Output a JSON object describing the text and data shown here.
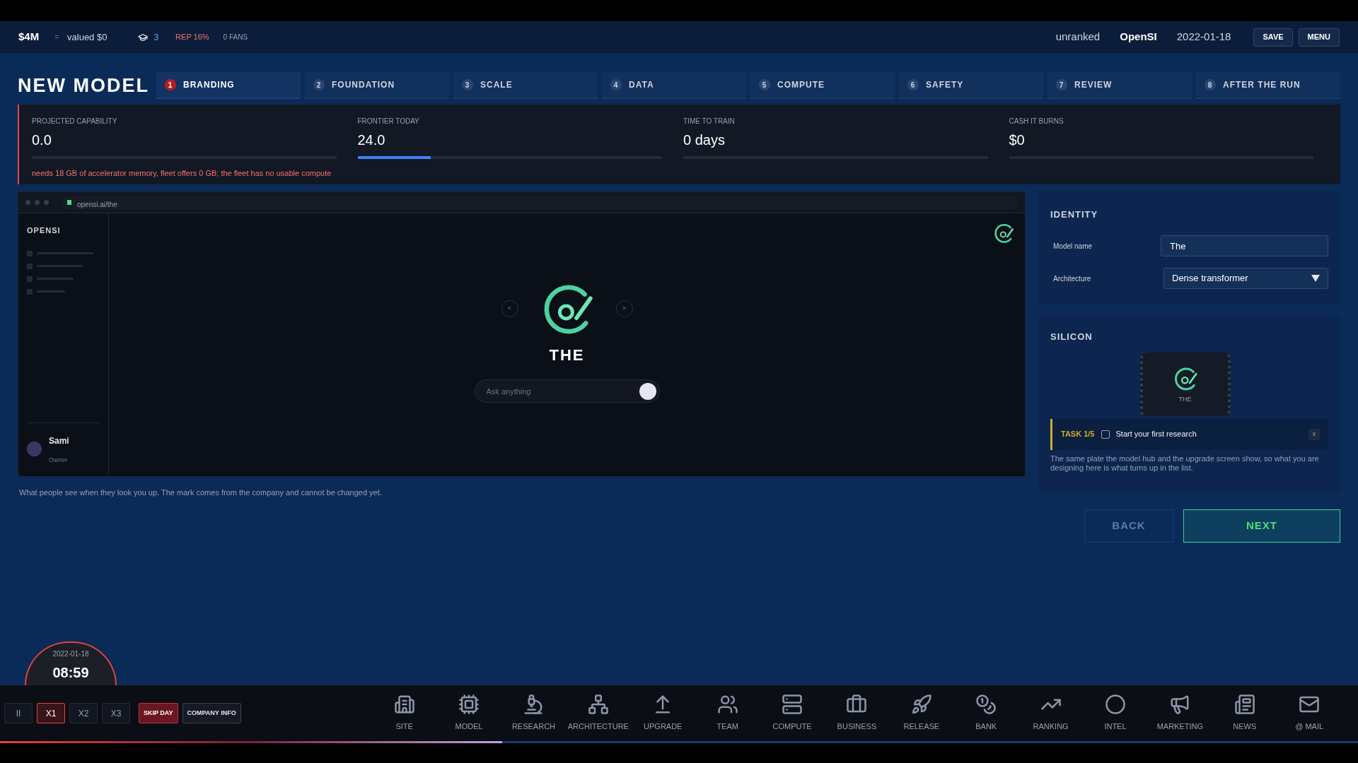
{
  "top_bar": {
    "cash": "$4M",
    "separator": "=",
    "valuation": "valued $0",
    "researchers": "3",
    "reputation": "REP 16%",
    "fans": "0 FANS",
    "rank": "unranked",
    "company": "OpenSI",
    "date": "2022-01-18",
    "buttons": [
      "SAVE",
      "MENU"
    ]
  },
  "page_title": "NEW MODEL",
  "steps": [
    {
      "number": "1",
      "label": "BRANDING",
      "selected": true
    },
    {
      "number": "2",
      "label": "FOUNDATION",
      "selected": false
    },
    {
      "number": "3",
      "label": "SCALE",
      "selected": false
    },
    {
      "number": "4",
      "label": "DATA",
      "selected": false
    },
    {
      "number": "5",
      "label": "COMPUTE",
      "selected": false
    },
    {
      "number": "6",
      "label": "SAFETY",
      "selected": false
    },
    {
      "number": "7",
      "label": "REVIEW",
      "selected": false
    },
    {
      "number": "8",
      "label": "AFTER THE RUN",
      "selected": false
    }
  ],
  "stats": [
    {
      "label": "PROJECTED CAPABILITY",
      "value": "0.0",
      "level": 0
    },
    {
      "label": "FRONTIER TODAY",
      "value": "24.0",
      "level": 0.24
    },
    {
      "label": "TIME TO TRAIN",
      "value": "0 days",
      "level": 0
    },
    {
      "label": "CASH IT BURNS",
      "value": "$0",
      "level": 0
    }
  ],
  "warning": "needs 18 GB of accelerator memory, fleet offers 0 GB; the fleet has no usable compute",
  "preview": {
    "url": "opensi.ai/the",
    "brand": "OPENSI",
    "model_name": "THE",
    "search_placeholder": "Ask anything",
    "user": {
      "name": "Sami",
      "role": "Owner"
    },
    "prev": "<",
    "next": ">"
  },
  "preview_caption": "What people see when they look you up. The mark comes from the company and cannot be changed yet.",
  "identity": {
    "title": "IDENTITY",
    "fields": [
      {
        "label": "Model name",
        "kind": "text",
        "value": "The"
      },
      {
        "label": "Architecture",
        "kind": "select",
        "value": "Dense transformer"
      }
    ]
  },
  "silicon": {
    "title": "SILICON",
    "chip_label": "THE",
    "description": "The same plate the model hub and the upgrade screen show, so what you are designing here is what turns up in the list."
  },
  "task": {
    "title": "TASK 1/5",
    "close": "x",
    "items": [
      {
        "label": "Start your first research",
        "checked": false
      }
    ]
  },
  "actions": [
    {
      "label": "BACK",
      "disabled": true
    },
    {
      "label": "NEXT",
      "disabled": false
    }
  ],
  "clock": {
    "date": "2022-01-18",
    "time": "08:59"
  },
  "speed": [
    {
      "label": "II",
      "selected": false
    },
    {
      "label": "X1",
      "selected": true
    },
    {
      "label": "X2",
      "selected": false
    },
    {
      "label": "X3",
      "selected": false
    }
  ],
  "controls": [
    {
      "label": "SKIP DAY",
      "kind": "danger"
    },
    {
      "label": "COMPANY INFO",
      "kind": "plain"
    }
  ],
  "nav": [
    {
      "label": "SITE",
      "kind": "site"
    },
    {
      "label": "MODEL",
      "kind": "model"
    },
    {
      "label": "RESEARCH",
      "kind": "research"
    },
    {
      "label": "ARCHITECTURE",
      "kind": "architecture"
    },
    {
      "label": "UPGRADE",
      "kind": "upgrade"
    },
    {
      "label": "TEAM",
      "kind": "team"
    },
    {
      "label": "COMPUTE",
      "kind": "compute"
    },
    {
      "label": "BUSINESS",
      "kind": "business"
    },
    {
      "label": "RELEASE",
      "kind": "release"
    },
    {
      "label": "BANK",
      "kind": "bank"
    },
    {
      "label": "RANKING",
      "kind": "ranking"
    },
    {
      "label": "INTEL",
      "kind": "intel"
    },
    {
      "label": "MARKETING",
      "kind": "marketing"
    },
    {
      "label": "NEWS",
      "kind": "news"
    },
    {
      "label": "@ MAIL",
      "kind": "mail"
    }
  ],
  "day_progress": {
    "level": 0.37
  }
}
